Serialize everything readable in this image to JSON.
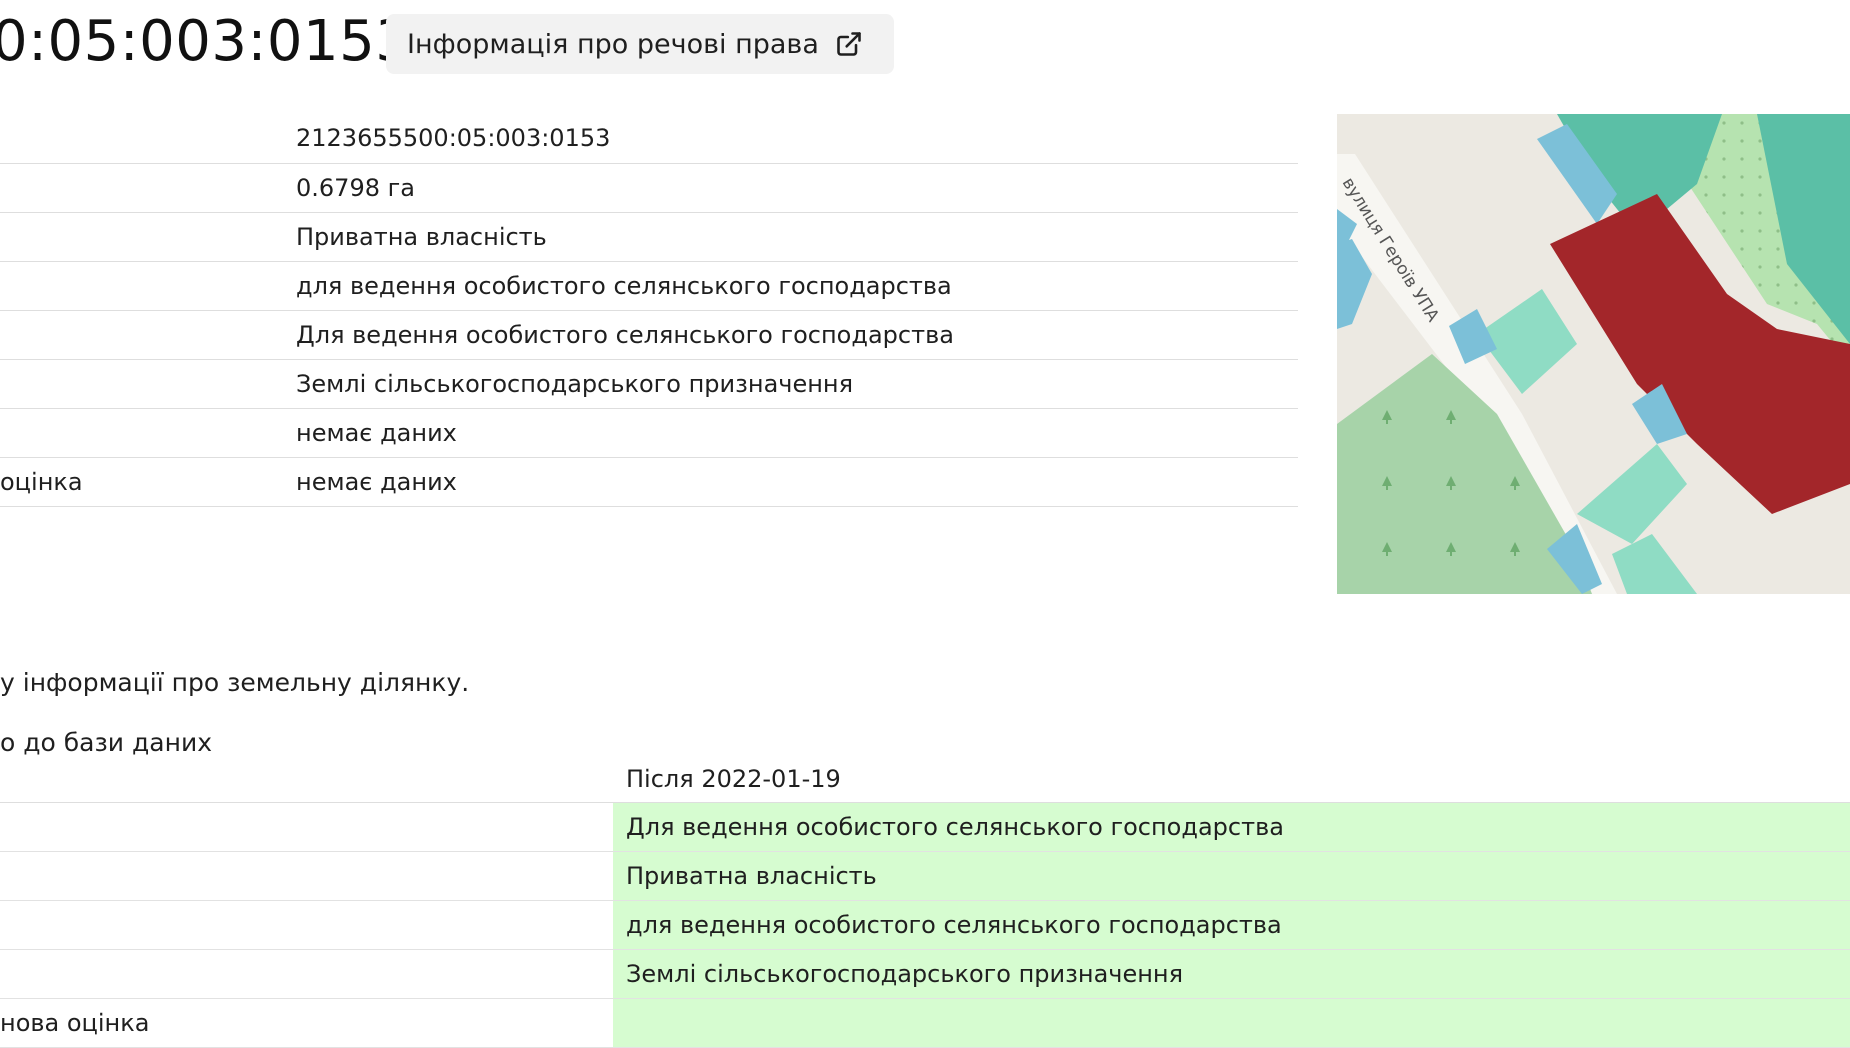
{
  "header": {
    "title": "0:05:003:0153",
    "rights_button_label": "Інформація про речові права"
  },
  "properties": [
    {
      "label": "",
      "value": "2123655500:05:003:0153"
    },
    {
      "label": "",
      "value": "0.6798 га"
    },
    {
      "label": "",
      "value": "Приватна власність"
    },
    {
      "label": "",
      "value": "для ведення особистого селянського господарства"
    },
    {
      "label": "",
      "value": "Для ведення особистого селянського господарства"
    },
    {
      "label": "",
      "value": "Землі сільськогосподарського призначення"
    },
    {
      "label": "",
      "value": "немає даних"
    },
    {
      "label": "оцінка",
      "value": "немає даних"
    }
  ],
  "map": {
    "street_label": "вулиця Героїв УПА",
    "colors": {
      "selected_parcel": "#a3262a",
      "parcel_teal": "#5bbfa6",
      "parcel_mint": "#8fdcc4",
      "parcel_blue": "#7cc0d8",
      "forest": "#a7d3a9",
      "meadow": "#b6e3b0",
      "road": "#f7f6f2",
      "background": "#ece9e2"
    }
  },
  "notice_text": "у інформації про земельну ділянку.",
  "db_label": "о до бази даних",
  "comparison": {
    "header": {
      "col1": "",
      "col2": "Після 2022-01-19"
    },
    "rows": [
      {
        "label": "",
        "value": "Для ведення особистого селянського господарства"
      },
      {
        "label": "",
        "value": "Приватна власність"
      },
      {
        "label": "",
        "value": "для ведення особистого селянського господарства"
      },
      {
        "label": "",
        "value": "Землі сільськогосподарського призначення"
      },
      {
        "label": "нова оцінка",
        "value": ""
      }
    ],
    "highlight_color": "#d6fcd0"
  }
}
